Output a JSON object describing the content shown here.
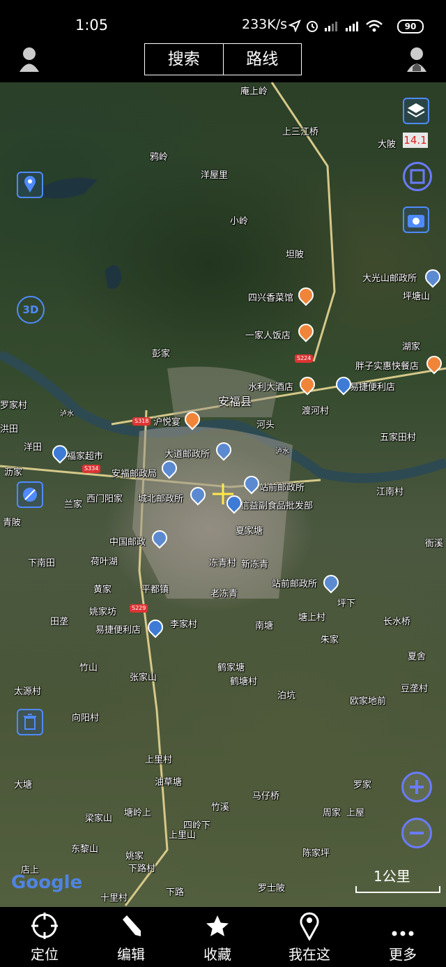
{
  "status_bar": {
    "time": "1:05",
    "net_speed": "233K/s",
    "battery": "90"
  },
  "top_bar": {
    "tab_search": "搜索",
    "tab_route": "路线"
  },
  "map": {
    "zoom_level": "14.1",
    "scale_label": "1公里",
    "google_label": "Google",
    "labels": [
      {
        "text": "庵上岭"
      },
      {
        "text": "上三江桥"
      },
      {
        "text": "大陂"
      },
      {
        "text": "鸦岭"
      },
      {
        "text": "洋屋里"
      },
      {
        "text": "小岭"
      },
      {
        "text": "坦陂"
      },
      {
        "text": "大光山邮政所"
      },
      {
        "text": "坪塘山"
      },
      {
        "text": "四兴香菜馆"
      },
      {
        "text": "一家人饭店"
      },
      {
        "text": "彭家"
      },
      {
        "text": "湖家"
      },
      {
        "text": "胖子实惠快餐店"
      },
      {
        "text": "水利大酒店"
      },
      {
        "text": "易捷便利店"
      },
      {
        "text": "安福县"
      },
      {
        "text": "渡河村"
      },
      {
        "text": "沪悦宴"
      },
      {
        "text": "河头"
      },
      {
        "text": "五家田村"
      },
      {
        "text": "大道邮政所"
      },
      {
        "text": "福家超市"
      },
      {
        "text": "安福邮政局"
      },
      {
        "text": "站前邮政所"
      },
      {
        "text": "西门阳家"
      },
      {
        "text": "城北邮政所"
      },
      {
        "text": "信益副食品批发部"
      },
      {
        "text": "夏家塘"
      },
      {
        "text": "江南村"
      },
      {
        "text": "中国邮政"
      },
      {
        "text": "衙溪"
      },
      {
        "text": "下南田"
      },
      {
        "text": "荷叶湖"
      },
      {
        "text": "冻青村"
      },
      {
        "text": "新冻青"
      },
      {
        "text": "站前邮政所"
      },
      {
        "text": "黄家"
      },
      {
        "text": "平都镇"
      },
      {
        "text": "老冻青"
      },
      {
        "text": "坪下"
      },
      {
        "text": "姚家坊"
      },
      {
        "text": "李家村"
      },
      {
        "text": "南塘"
      },
      {
        "text": "塘上村"
      },
      {
        "text": "长水桥"
      },
      {
        "text": "易捷便利店"
      },
      {
        "text": "朱家"
      },
      {
        "text": "田垄"
      },
      {
        "text": "竹山"
      },
      {
        "text": "鹤家塘"
      },
      {
        "text": "夏舍"
      },
      {
        "text": "张家山"
      },
      {
        "text": "鹤塘村"
      },
      {
        "text": "太源村"
      },
      {
        "text": "泊坑"
      },
      {
        "text": "豆垄村"
      },
      {
        "text": "向阳村"
      },
      {
        "text": "欧家地前"
      },
      {
        "text": "上里村"
      },
      {
        "text": "油草塘"
      },
      {
        "text": "大塘"
      },
      {
        "text": "罗家"
      },
      {
        "text": "竹溪"
      },
      {
        "text": "马仔桥"
      },
      {
        "text": "塘岭上"
      },
      {
        "text": "梁家山"
      },
      {
        "text": "周家"
      },
      {
        "text": "上屋"
      },
      {
        "text": "四岭下"
      },
      {
        "text": "上里山"
      },
      {
        "text": "东黎山"
      },
      {
        "text": "陈家坪"
      },
      {
        "text": "姚家"
      },
      {
        "text": "下路村"
      },
      {
        "text": "店上"
      },
      {
        "text": "罗士陂"
      },
      {
        "text": "十里村"
      },
      {
        "text": "下路"
      },
      {
        "text": "罗家村"
      },
      {
        "text": "洪田"
      },
      {
        "text": "洋田"
      },
      {
        "text": "沥家"
      },
      {
        "text": "兰家"
      },
      {
        "text": "青陂"
      },
      {
        "text": "泸水"
      },
      {
        "text": "泸水"
      }
    ],
    "road_shields": [
      "S318",
      "S334",
      "S224",
      "S229"
    ]
  },
  "bottom_nav": [
    {
      "label": "定位",
      "icon": "target-icon"
    },
    {
      "label": "编辑",
      "icon": "pencil-icon"
    },
    {
      "label": "收藏",
      "icon": "star-icon"
    },
    {
      "label": "我在这",
      "icon": "pin-icon"
    },
    {
      "label": "更多",
      "icon": "more-icon"
    }
  ]
}
